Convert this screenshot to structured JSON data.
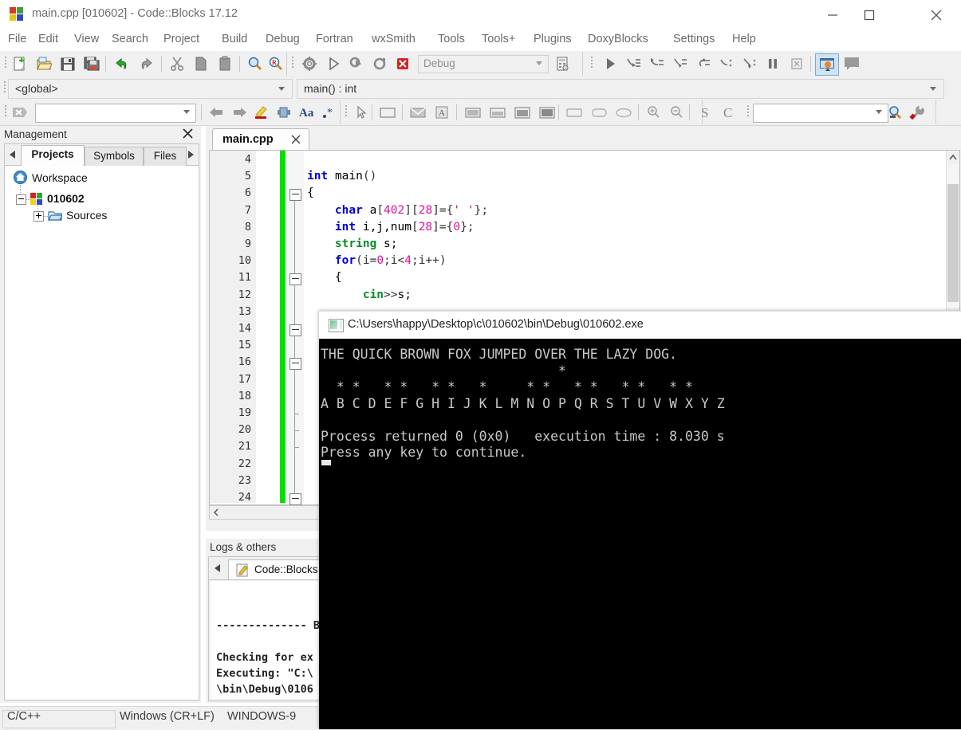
{
  "window": {
    "title": "main.cpp [010602] - Code::Blocks 17.12",
    "icon": "codeblocks-logo-icon",
    "controls": {
      "minimize": "minimize-icon",
      "maximize": "maximize-icon",
      "close": "close-icon"
    }
  },
  "menubar": {
    "items": [
      "File",
      "Edit",
      "View",
      "Search",
      "Project",
      "Build",
      "Debug",
      "Fortran",
      "wxSmith",
      "Tools",
      "Tools+",
      "Plugins",
      "DoxyBlocks",
      "Settings",
      "Help"
    ]
  },
  "toolbar_main": {
    "icons": [
      "new-file-icon",
      "open-file-icon",
      "save-icon",
      "save-all-icon",
      "undo-icon",
      "redo-icon",
      "cut-icon",
      "copy-icon",
      "paste-icon",
      "find-icon",
      "replace-icon"
    ]
  },
  "toolbar_compiler": {
    "icons": [
      "build-icon",
      "run-icon",
      "build-and-run-icon",
      "rebuild-icon",
      "abort-icon"
    ],
    "target": {
      "value": "Debug",
      "placeholder": "Debug"
    },
    "extra_icon": "build-target-options-icon"
  },
  "toolbar_debugger": {
    "icons": [
      "debug-continue-icon",
      "run-to-cursor-icon",
      "next-line-icon",
      "step-into-icon",
      "step-out-icon",
      "next-instruction-icon",
      "step-into-instruction-icon",
      "break-debugger-icon",
      "stop-debugger-icon",
      "debugging-windows-icon",
      "various-info-icon"
    ]
  },
  "scopebar": {
    "scope": {
      "value": "<global>"
    },
    "function": {
      "value": "main() : int"
    }
  },
  "toolbar_find": {
    "clear_icon": "clear-search-icon",
    "search": {
      "value": "",
      "placeholder": ""
    },
    "icons": [
      "find-previous-icon",
      "find-next-icon",
      "highlight-icon",
      "selected-text-icon",
      "match-case-icon",
      "regex-icon"
    ]
  },
  "toolbar_wxsmith": {
    "icons": [
      "pointer-icon",
      "panel-icon",
      "dialog-icon",
      "frame-icon",
      "preview-normal-icon",
      "preview-wide-icon",
      "preview-tall-icon",
      "preview-full-icon",
      "zoom-shape-1-icon",
      "zoom-shape-2-icon",
      "zoom-shape-3-icon",
      "zoom-in-icon",
      "zoom-out-icon",
      "script-s-icon",
      "script-c-icon"
    ]
  },
  "toolbar_doxyblocks": {
    "search": {
      "value": "",
      "placeholder": ""
    },
    "icons": [
      "doxy-search-icon",
      "doxy-config-icon"
    ]
  },
  "management": {
    "title": "Management",
    "close_icon": "close-icon",
    "tabs": [
      {
        "label": "Projects",
        "active": true
      },
      {
        "label": "Symbols",
        "active": false
      },
      {
        "label": "Files",
        "active": false
      }
    ],
    "tab_scroll_left": "chevron-left-icon",
    "tab_scroll_right": "chevron-right-icon",
    "tree": [
      {
        "label": "Workspace",
        "icon": "workspace-home-icon",
        "indent": 0,
        "expander": null
      },
      {
        "label": "010602",
        "icon": "project-icon",
        "indent": 1,
        "expander": "minus",
        "bold": true
      },
      {
        "label": "Sources",
        "icon": "folder-icon",
        "indent": 2,
        "expander": "plus"
      }
    ]
  },
  "editor": {
    "tab": {
      "label": "main.cpp",
      "close_icon": "close-icon"
    },
    "first_line": 4,
    "lines": [
      {
        "n": 4,
        "tokens": []
      },
      {
        "n": 5,
        "tokens": [
          {
            "t": "int",
            "c": "k"
          },
          {
            "t": " ",
            "c": "pln"
          },
          {
            "t": "main",
            "c": "pln"
          },
          {
            "t": "()",
            "c": "op"
          }
        ]
      },
      {
        "n": 6,
        "tokens": [
          {
            "t": "{",
            "c": "pln"
          }
        ]
      },
      {
        "n": 7,
        "tokens": [
          {
            "t": "    char",
            "c": "k"
          },
          {
            "t": " a",
            "c": "pln"
          },
          {
            "t": "[",
            "c": "op"
          },
          {
            "t": "402",
            "c": "num"
          },
          {
            "t": "][",
            "c": "op"
          },
          {
            "t": "28",
            "c": "num"
          },
          {
            "t": "]={",
            "c": "op"
          },
          {
            "t": "' '",
            "c": "str"
          },
          {
            "t": "};",
            "c": "op"
          }
        ]
      },
      {
        "n": 8,
        "tokens": [
          {
            "t": "    int",
            "c": "k"
          },
          {
            "t": " i,j,num",
            "c": "pln"
          },
          {
            "t": "[",
            "c": "op"
          },
          {
            "t": "28",
            "c": "num"
          },
          {
            "t": "]={",
            "c": "op"
          },
          {
            "t": "0",
            "c": "num"
          },
          {
            "t": "};",
            "c": "op"
          }
        ]
      },
      {
        "n": 9,
        "tokens": [
          {
            "t": "    string",
            "c": "kt"
          },
          {
            "t": " s;",
            "c": "pln"
          }
        ]
      },
      {
        "n": 10,
        "tokens": [
          {
            "t": "    for",
            "c": "k"
          },
          {
            "t": "(i=",
            "c": "op"
          },
          {
            "t": "0",
            "c": "num"
          },
          {
            "t": ";i<",
            "c": "op"
          },
          {
            "t": "4",
            "c": "num"
          },
          {
            "t": ";i++)",
            "c": "op"
          }
        ]
      },
      {
        "n": 11,
        "tokens": [
          {
            "t": "    {",
            "c": "pln"
          }
        ]
      },
      {
        "n": 12,
        "tokens": [
          {
            "t": "        cin",
            "c": "kt"
          },
          {
            "t": ">>",
            "c": "op"
          },
          {
            "t": "s;",
            "c": "pln"
          }
        ]
      },
      {
        "n": 13,
        "tokens": []
      },
      {
        "n": 14,
        "tokens": []
      },
      {
        "n": 15,
        "tokens": []
      },
      {
        "n": 16,
        "tokens": []
      },
      {
        "n": 17,
        "tokens": []
      },
      {
        "n": 18,
        "tokens": []
      },
      {
        "n": 19,
        "tokens": []
      },
      {
        "n": 20,
        "tokens": []
      },
      {
        "n": 21,
        "tokens": []
      },
      {
        "n": 22,
        "tokens": []
      },
      {
        "n": 23,
        "tokens": []
      },
      {
        "n": 24,
        "tokens": []
      }
    ],
    "fold_markers": [
      {
        "line": 6,
        "type": "box"
      },
      {
        "line": 11,
        "type": "box"
      },
      {
        "line": 14,
        "type": "box"
      },
      {
        "line": 16,
        "type": "box"
      },
      {
        "line": 19,
        "type": "tick"
      },
      {
        "line": 20,
        "type": "tick"
      },
      {
        "line": 21,
        "type": "tick"
      },
      {
        "line": 24,
        "type": "box"
      }
    ],
    "scrollbar_up_icon": "chevron-up-icon",
    "hscroll_left_icon": "chevron-left-icon"
  },
  "logs": {
    "title": "Logs & others",
    "tab": {
      "label": "Code::Blocks",
      "icon": "pencil-log-icon"
    },
    "scroll_left_icon": "chevron-left-icon",
    "lines": [
      "",
      "-------------- B",
      "",
      "Checking for ex",
      "Executing: \"C:\\",
      "\\bin\\Debug\\0106"
    ]
  },
  "statusbar": {
    "language": "C/C++",
    "eol": "Windows (CR+LF)",
    "encoding": "WINDOWS-9"
  },
  "console": {
    "title": "C:\\Users\\happy\\Desktop\\c\\010602\\bin\\Debug\\010602.exe",
    "icon": "console-window-icon",
    "output": [
      "THE QUICK BROWN FOX JUMPED OVER THE LAZY DOG.",
      "                              *",
      "  * *   * *   * *   *     * *   * *   * *   * *",
      "A B C D E F G H I J K L M N O P Q R S T U V W X Y Z",
      "",
      "Process returned 0 (0x0)   execution time : 8.030 s",
      "Press any key to continue."
    ],
    "cursor": "block-caret"
  },
  "colors": {
    "window_bg": "#ffffff",
    "chrome_bg": "#f0f0f0",
    "console_bg": "#000000",
    "console_fg": "#c8c8c8",
    "keyword": "#0000d0",
    "type": "#0b8a2b",
    "number": "#e0119d",
    "string": "#d01414",
    "changed_marker": "#00e000"
  }
}
